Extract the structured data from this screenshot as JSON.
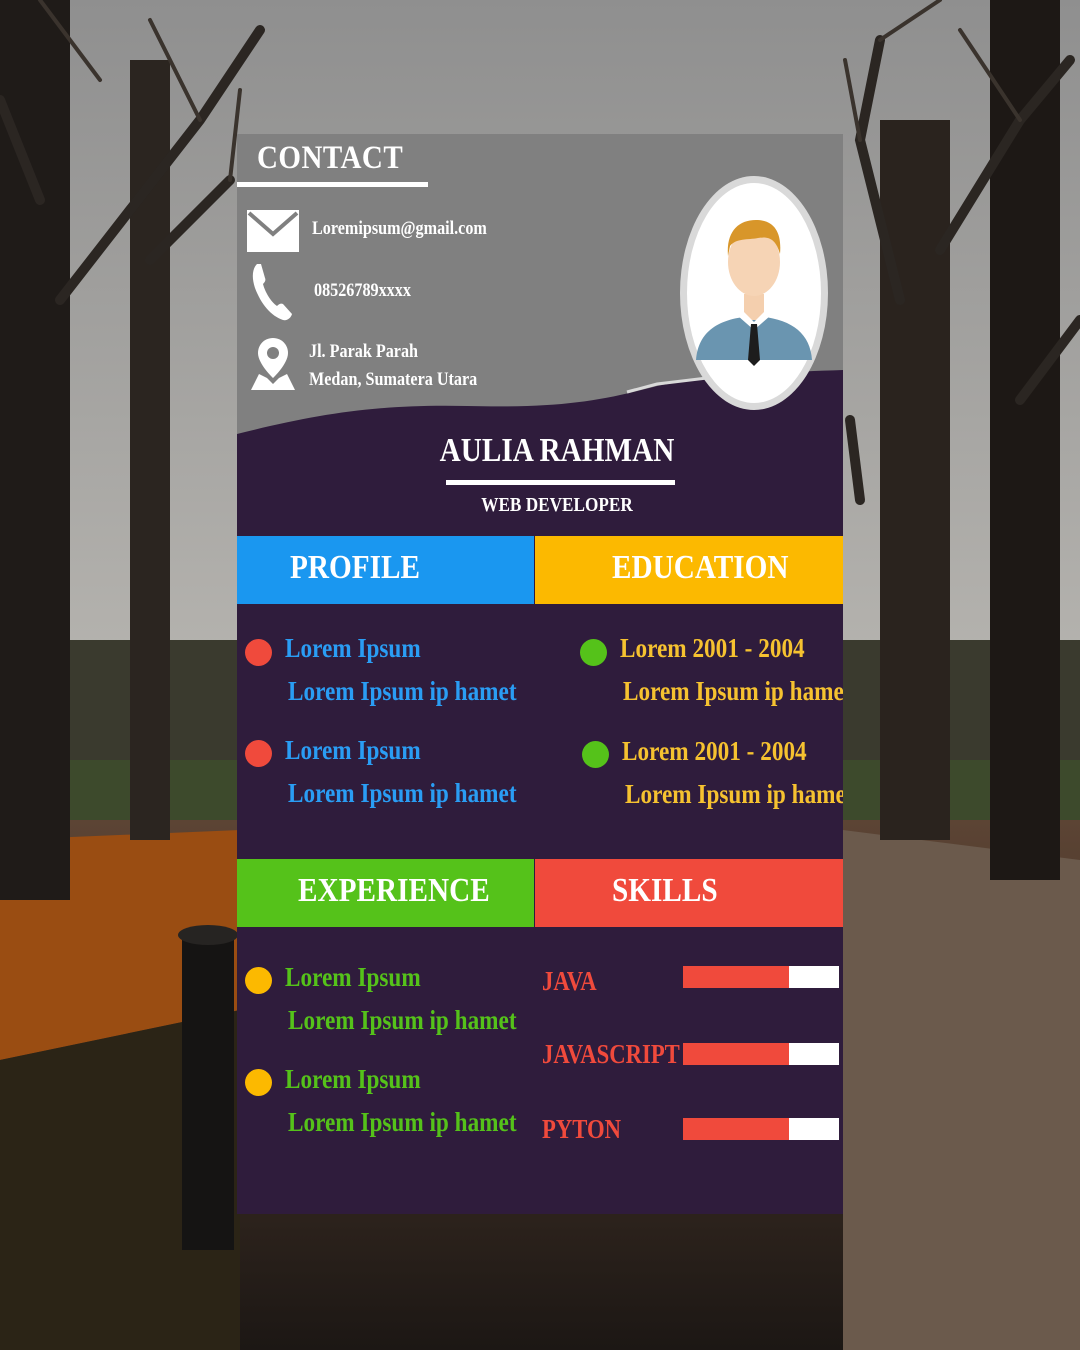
{
  "contact": {
    "title": "CONTACT",
    "email": "Loremipsum@gmail.com",
    "phone": "08526789xxxx",
    "address_line1": "Jl. Parak Parah",
    "address_line2": "Medan, Sumatera Utara",
    "icons": [
      "mail-icon",
      "phone-icon",
      "location-pin-icon"
    ]
  },
  "person": {
    "name": "AULIA RAHMAN",
    "role": "WEB DEVELOPER"
  },
  "sections": {
    "profile": {
      "title": "PROFILE",
      "items": [
        {
          "title": "Lorem Ipsum",
          "desc": "Lorem Ipsum ip hamet"
        },
        {
          "title": "Lorem Ipsum",
          "desc": "Lorem Ipsum ip hamet"
        }
      ]
    },
    "education": {
      "title": "EDUCATION",
      "items": [
        {
          "title": "Lorem 2001 - 2004",
          "desc": "Lorem Ipsum ip hamet"
        },
        {
          "title": "Lorem 2001 - 2004",
          "desc": "Lorem Ipsum ip hamet"
        }
      ]
    },
    "experience": {
      "title": "EXPERIENCE",
      "items": [
        {
          "title": "Lorem Ipsum",
          "desc": "Lorem Ipsum ip hamet"
        },
        {
          "title": "Lorem Ipsum",
          "desc": "Lorem Ipsum ip hamet"
        }
      ]
    },
    "skills": {
      "title": "SKILLS",
      "items": [
        {
          "name": "JAVA",
          "level": 0.68
        },
        {
          "name": "JAVASCRIPT",
          "level": 0.68
        },
        {
          "name": "PYTON",
          "level": 0.68
        }
      ]
    }
  },
  "colors": {
    "card_background": "#2f1c3c",
    "header_gray": "#808080",
    "profile_band": "#1a97f0",
    "education_band": "#fcb900",
    "experience_band": "#55c21a",
    "skills_band": "#f04a3c"
  }
}
